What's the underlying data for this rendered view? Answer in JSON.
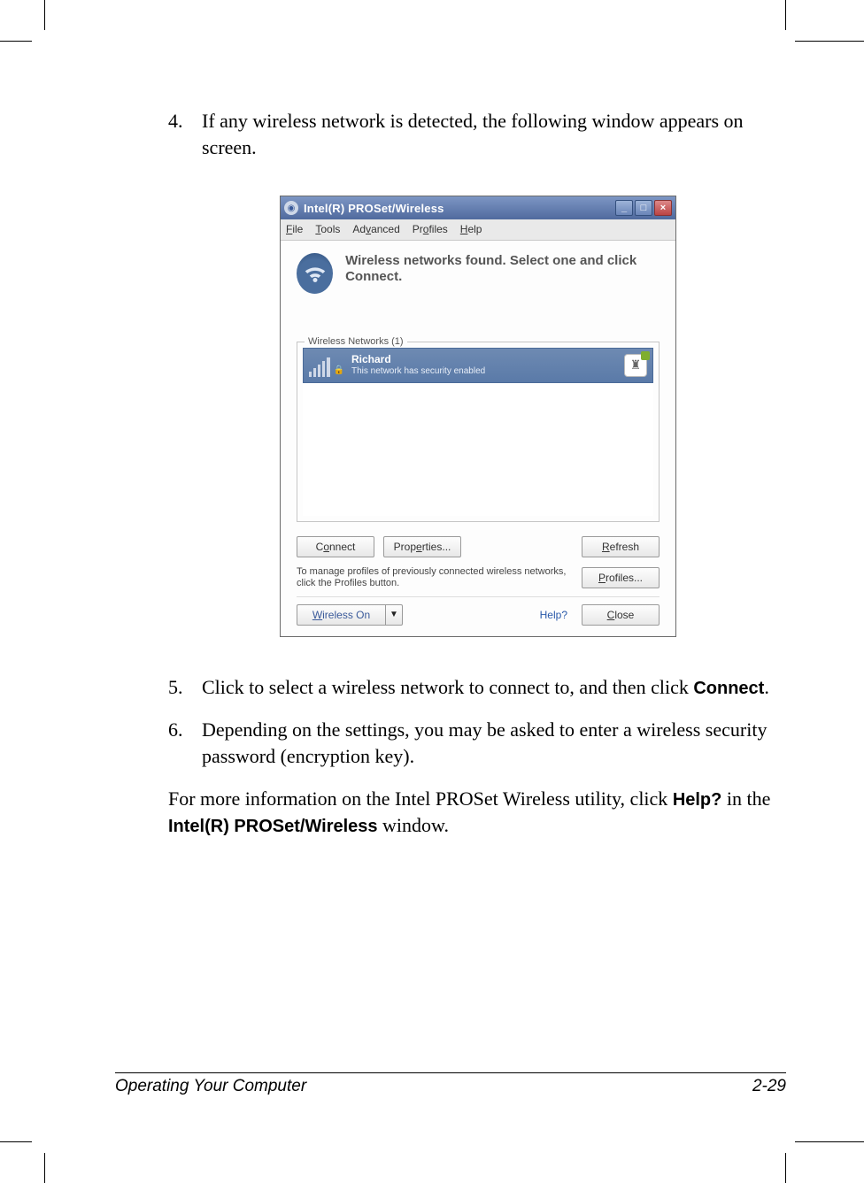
{
  "steps": {
    "s4": {
      "num": "4.",
      "text": "If any wireless network is detected, the following window appears on screen."
    },
    "s5": {
      "num": "5.",
      "text_a": "Click to select a wireless network to connect to, and then click ",
      "bold": "Connect",
      "text_b": "."
    },
    "s6": {
      "num": "6.",
      "text": "Depending on the settings, you may be asked to enter a wireless security password (encryption key)."
    }
  },
  "closing": {
    "a": "For more information on the Intel PROSet Wireless utility, click ",
    "help_bold": "Help?",
    "b": " in the ",
    "win_bold": "Intel(R) PROSet/Wireless",
    "c": " window."
  },
  "window": {
    "title": "Intel(R) PROSet/Wireless",
    "menu": {
      "file": "File",
      "tools": "Tools",
      "advanced": "Advanced",
      "profiles": "Profiles",
      "help": "Help"
    },
    "header_text": "Wireless networks found. Select one and click Connect.",
    "group_label": "Wireless Networks (1)",
    "network": {
      "name": "Richard",
      "desc": "This network has security enabled"
    },
    "buttons": {
      "connect": "Connect",
      "properties": "Properties...",
      "refresh": "Refresh",
      "profiles": "Profiles...",
      "close": "Close",
      "wireless_on": "Wireless On"
    },
    "hint": "To manage profiles of previously connected wireless networks, click the Profiles button.",
    "help_link": "Help?"
  },
  "footer": {
    "left": "Operating Your Computer",
    "right": "2-29"
  }
}
